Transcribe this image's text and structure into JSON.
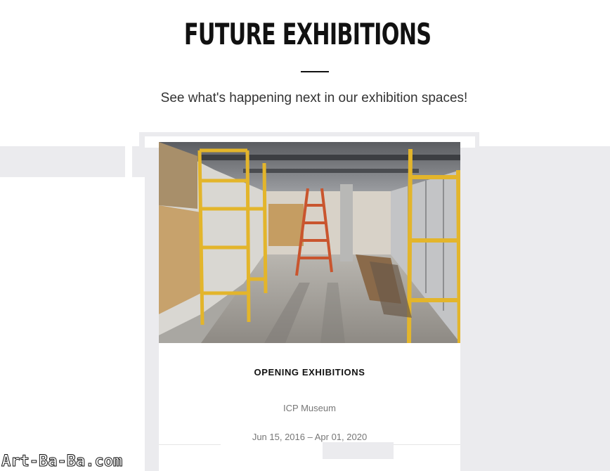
{
  "header": {
    "title": "FUTURE EXHIBITIONS",
    "subtitle": "See what's happening next in our exhibition spaces!"
  },
  "card": {
    "image_alt": "Gallery under construction with scaffolding and ladder",
    "title": "OPENING EXHIBITIONS",
    "venue": "ICP Museum",
    "dates": "Jun 15, 2016 – Apr 01, 2020"
  },
  "watermark": "Art-Ba-Ba.com",
  "colors": {
    "band": "#ebebee",
    "scaffold": "#e3b52b",
    "ladder": "#c9552e"
  }
}
